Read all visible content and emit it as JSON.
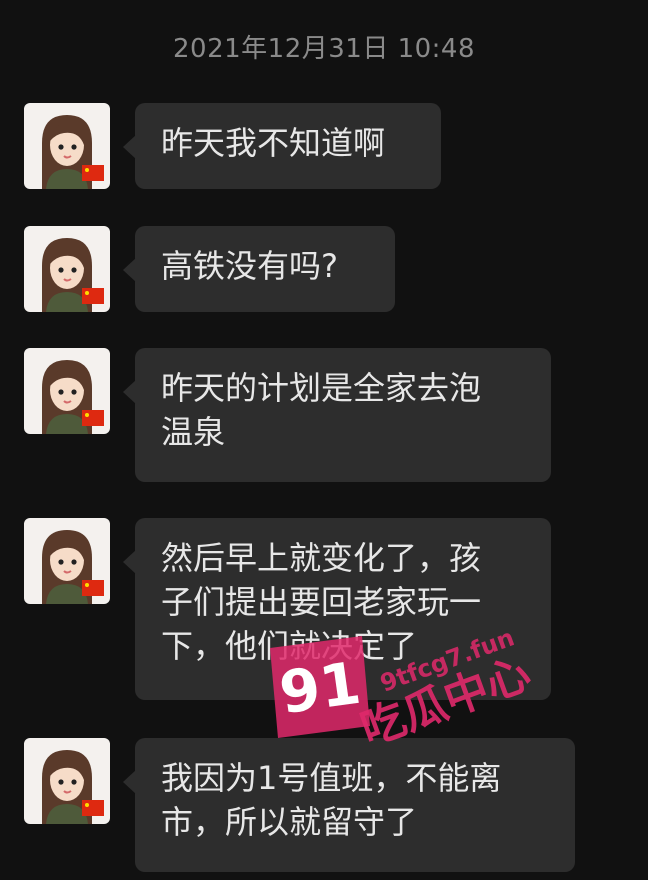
{
  "timestamp": "2021年12月31日 10:48",
  "messages": [
    {
      "text": "昨天我不知道啊"
    },
    {
      "text": "高铁没有吗?"
    },
    {
      "text": "昨天的计划是全家去泡\n温泉"
    },
    {
      "text": "然后早上就变化了，孩\n子们提出要回老家玩一\n下，他们就决定了"
    },
    {
      "text": "我因为1号值班，不能离\n市，所以就留守了"
    }
  ],
  "watermark": {
    "number": "91",
    "name": "吃瓜中心",
    "url": "9tfcg7.fun"
  },
  "colors": {
    "background": "#111111",
    "bubble": "#2d2d2d",
    "bubble_text": "#e7e7e7",
    "timestamp": "#8a8a8a",
    "watermark": "#e0296b"
  }
}
